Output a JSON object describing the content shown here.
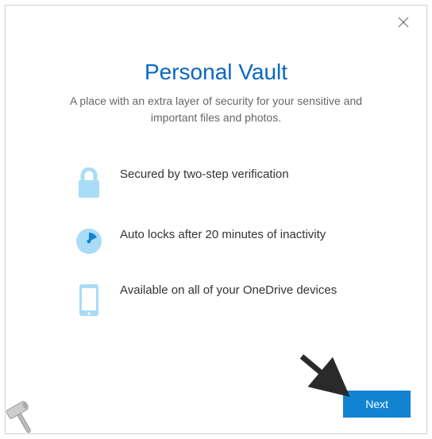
{
  "dialog": {
    "title": "Personal Vault",
    "subtitle": "A place with an extra layer of security for your sensitive and important files and photos.",
    "features": [
      {
        "icon": "lock-icon",
        "text": "Secured by two-step verification"
      },
      {
        "icon": "clock-icon",
        "text": "Auto locks after 20 minutes of inactivity"
      },
      {
        "icon": "phone-icon",
        "text": "Available on all of your OneDrive devices"
      }
    ],
    "next_label": "Next",
    "close_label": "Close"
  },
  "colors": {
    "accent": "#0a66c2",
    "button": "#1083d3",
    "icon_light": "#a9dcf6"
  }
}
